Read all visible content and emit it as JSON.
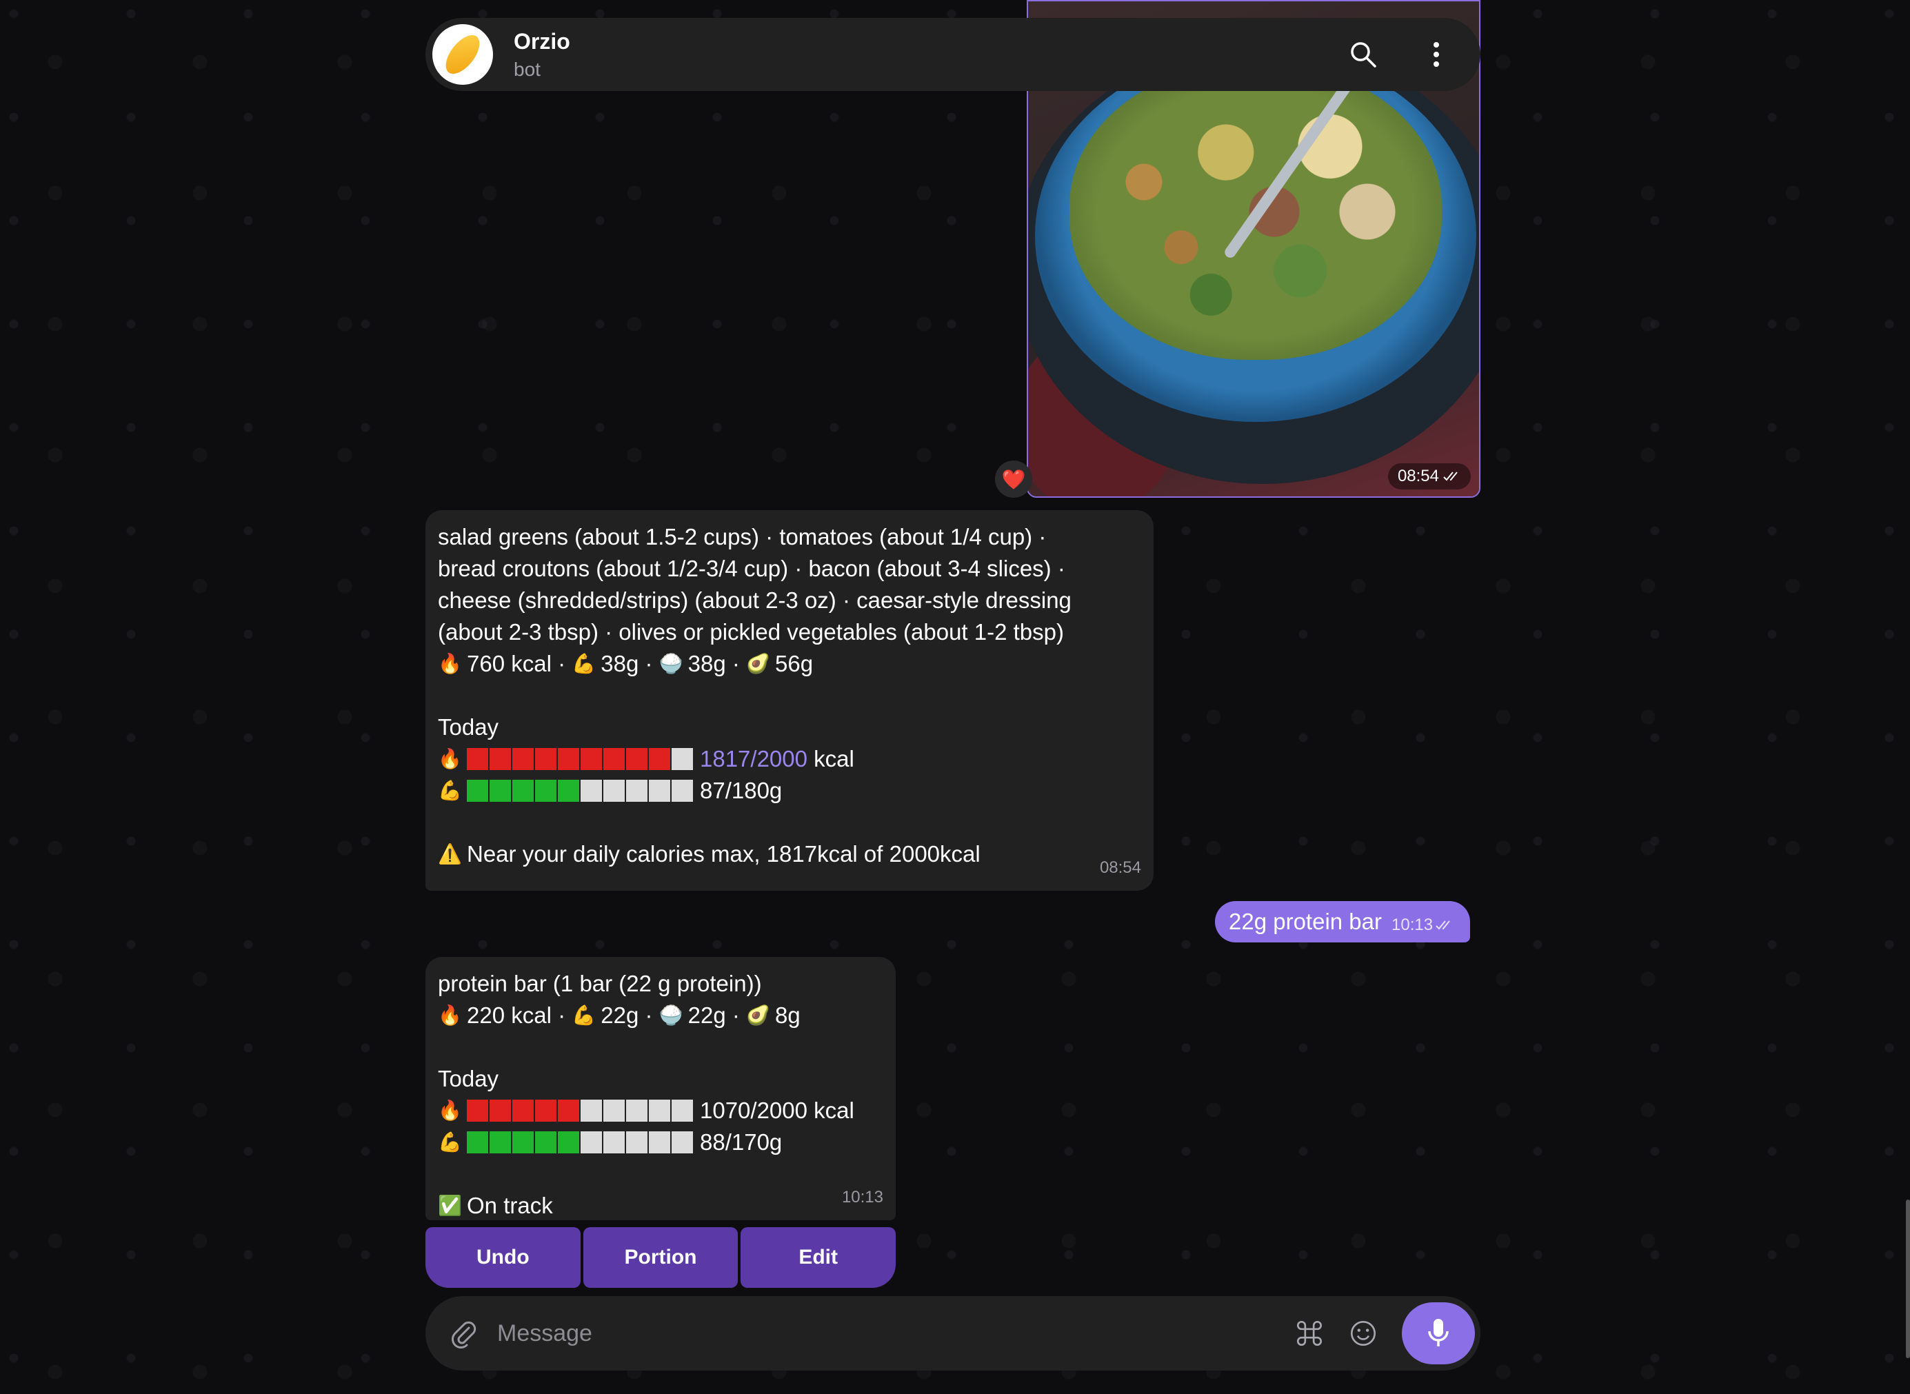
{
  "header": {
    "title": "Orzio",
    "subtitle": "bot"
  },
  "photo_message": {
    "time": "08:54",
    "reaction": "❤️"
  },
  "message1": {
    "lines": [
      "salad greens (about 1.5-2 cups) · tomatoes (about 1/4 cup) ·",
      "bread croutons (about 1/2-3/4 cup) · bacon (about 3-4 slices) ·",
      "cheese (shredded/strips) (about 2-3 oz) · caesar-style dressing",
      "(about 2-3 tbsp) · olives or pickled vegetables (about 1-2 tbsp)"
    ],
    "macros": {
      "kcal": "760 kcal",
      "protein": "38g",
      "carbs": "38g",
      "fat": "56g"
    },
    "today_label": "Today",
    "kcal_progress": {
      "fraction": 0.9,
      "text_accent": "1817/2000",
      "text_unit": "kcal"
    },
    "protein_progress": {
      "fraction": 0.5,
      "text": "87/180g"
    },
    "warning": "Near your daily calories max, 1817kcal of 2000kcal",
    "time": "08:54"
  },
  "outgoing": {
    "text": "22g protein bar",
    "time": "10:13"
  },
  "message2": {
    "line": "protein bar (1 bar (22 g protein))",
    "macros": {
      "kcal": "220 kcal",
      "protein": "22g",
      "carbs": "22g",
      "fat": "8g"
    },
    "today_label": "Today",
    "kcal_progress": {
      "fraction": 0.5,
      "text": "1070/2000 kcal"
    },
    "protein_progress": {
      "fraction": 0.5,
      "text": "88/170g"
    },
    "status": "On track",
    "time": "10:13"
  },
  "keyboard": {
    "undo": "Undo",
    "portion": "Portion",
    "edit": "Edit"
  },
  "input": {
    "placeholder": "Message"
  },
  "colors": {
    "accent": "#8a6fe6",
    "bubble": "#212121",
    "bar_red": "#e0211f",
    "bar_green": "#1fb52c"
  },
  "icons": {
    "fire": "🔥",
    "muscle": "💪",
    "rice": "🍚",
    "avocado": "🥑",
    "warning": "⚠️",
    "check": "✅"
  }
}
